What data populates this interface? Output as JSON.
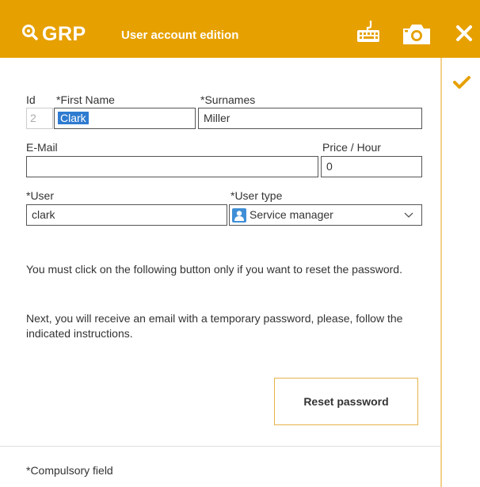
{
  "header": {
    "logo_text": "GRP",
    "title": "User account edition",
    "color": "#e6a000"
  },
  "icons": {
    "logo": "search-logo-icon",
    "keyboard": "keyboard-icon",
    "camera": "camera-icon",
    "close": "close-icon",
    "confirm": "checkmark-icon"
  },
  "form": {
    "id": {
      "label": "Id",
      "value": "2"
    },
    "first_name": {
      "label": "*First Name",
      "value": "Clark"
    },
    "surnames": {
      "label": "*Surnames",
      "value": "Miller"
    },
    "email": {
      "label": "E-Mail",
      "value": ""
    },
    "price_hour": {
      "label": "Price / Hour",
      "value": "0"
    },
    "user": {
      "label": "*User",
      "value": "clark"
    },
    "user_type": {
      "label": "*User type",
      "value": "Service manager"
    }
  },
  "notes": {
    "p1": "You must click on the following button only if you want to reset the password.",
    "p2": "Next, you will receive an email with a temporary password, please, follow the indicated instructions."
  },
  "reset_button": "Reset password",
  "footer": "*Compulsory field"
}
